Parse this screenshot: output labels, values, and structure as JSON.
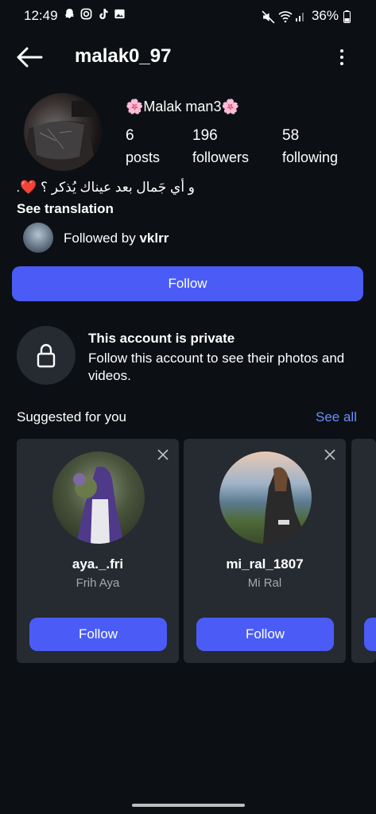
{
  "status_bar": {
    "time": "12:49",
    "battery": "36%"
  },
  "header": {
    "username": "malak0_97"
  },
  "profile": {
    "display_name": "🌸Malak man3🌸",
    "stats": [
      {
        "value": "6",
        "label": "posts"
      },
      {
        "value": "196",
        "label": "followers"
      },
      {
        "value": "58",
        "label": "following"
      }
    ],
    "bio": "و أي جَمال بعد عيناك يُذكر ؟ ❤️.",
    "see_translation": "See translation",
    "followed_by_prefix": "Followed by",
    "followed_by_user": "vklrr",
    "follow_label": "Follow"
  },
  "private": {
    "title": "This account is private",
    "description": "Follow this account to see their photos and videos."
  },
  "suggested": {
    "title": "Suggested for you",
    "see_all": "See all",
    "cards": [
      {
        "username": "aya._.fri",
        "name": "Frih Aya",
        "button": "Follow"
      },
      {
        "username": "mi_ral_1807",
        "name": "Mi Ral",
        "button": "Follow"
      }
    ]
  },
  "colors": {
    "accent": "#4a5cf5",
    "link": "#6b8cff",
    "background": "#0c1014",
    "card": "#262a31"
  }
}
